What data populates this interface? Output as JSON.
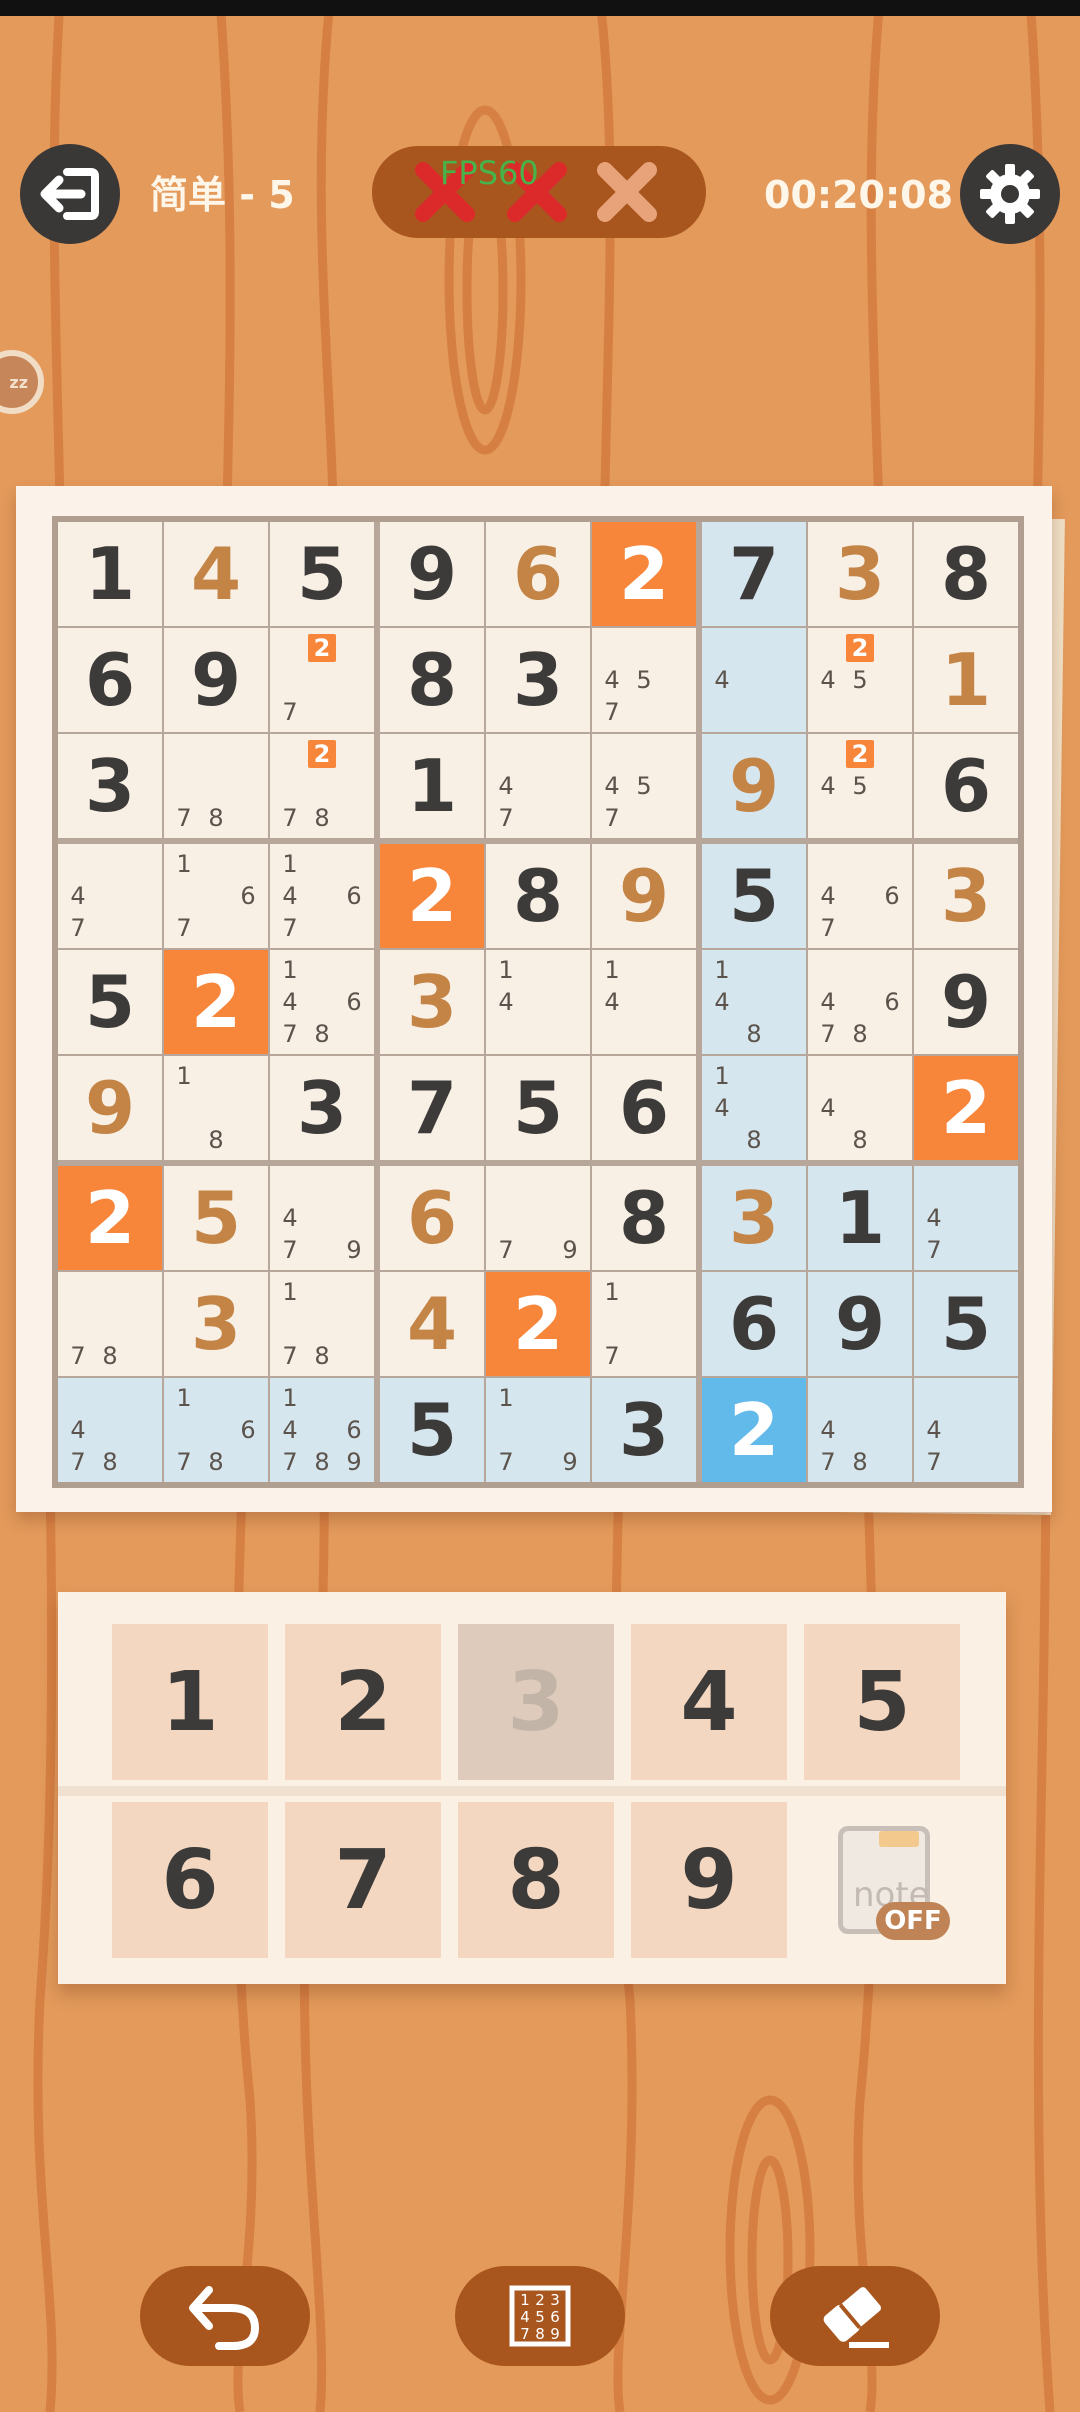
{
  "header": {
    "level_label": "简单 - 5",
    "timer": "00:20:08",
    "fps_overlay": "FPS60",
    "mistakes": {
      "made": 2,
      "max": 3
    },
    "exit_icon": "exit-icon",
    "settings_icon": "gear-icon"
  },
  "side_tab": {
    "label": "zz"
  },
  "board": {
    "selected_cell": [
      8,
      6
    ],
    "highlight_color": "#d6e6ee",
    "conflict_color": "#f7853a",
    "selected_color": "#62baea",
    "rows": [
      [
        {
          "v": "1",
          "t": "given"
        },
        {
          "v": "4",
          "t": "user"
        },
        {
          "v": "5",
          "t": "given"
        },
        {
          "v": "9",
          "t": "given"
        },
        {
          "v": "6",
          "t": "user"
        },
        {
          "v": "2",
          "t": "conf"
        },
        {
          "v": "7",
          "t": "given",
          "hl": true
        },
        {
          "v": "3",
          "t": "user"
        },
        {
          "v": "8",
          "t": "given"
        }
      ],
      [
        {
          "v": "6",
          "t": "given"
        },
        {
          "v": "9",
          "t": "given"
        },
        {
          "n": [
            7
          ],
          "o": [
            2
          ]
        },
        {
          "v": "8",
          "t": "given"
        },
        {
          "v": "3",
          "t": "given"
        },
        {
          "n": [
            4,
            5,
            7
          ]
        },
        {
          "n": [
            4
          ],
          "hl": true
        },
        {
          "n": [
            4,
            5
          ],
          "o": [
            2
          ]
        },
        {
          "v": "1",
          "t": "user"
        }
      ],
      [
        {
          "v": "3",
          "t": "given"
        },
        {
          "n": [
            7,
            8
          ]
        },
        {
          "n": [
            7,
            8
          ],
          "o": [
            2
          ]
        },
        {
          "v": "1",
          "t": "given"
        },
        {
          "n": [
            4,
            7
          ]
        },
        {
          "n": [
            4,
            5,
            7
          ]
        },
        {
          "v": "9",
          "t": "user",
          "hl": true
        },
        {
          "n": [
            4,
            5
          ],
          "o": [
            2
          ]
        },
        {
          "v": "6",
          "t": "given"
        }
      ],
      [
        {
          "n": [
            4,
            7
          ]
        },
        {
          "n": [
            1,
            6,
            7
          ]
        },
        {
          "n": [
            1,
            4,
            6,
            7
          ]
        },
        {
          "v": "2",
          "t": "conf"
        },
        {
          "v": "8",
          "t": "given"
        },
        {
          "v": "9",
          "t": "user"
        },
        {
          "v": "5",
          "t": "given",
          "hl": true
        },
        {
          "n": [
            4,
            6,
            7
          ]
        },
        {
          "v": "3",
          "t": "user"
        }
      ],
      [
        {
          "v": "5",
          "t": "given"
        },
        {
          "v": "2",
          "t": "conf"
        },
        {
          "n": [
            1,
            4,
            6,
            7,
            8
          ]
        },
        {
          "v": "3",
          "t": "user"
        },
        {
          "n": [
            1,
            4
          ]
        },
        {
          "n": [
            1,
            4
          ]
        },
        {
          "n": [
            1,
            4,
            8
          ],
          "hl": true
        },
        {
          "n": [
            4,
            6,
            7,
            8
          ]
        },
        {
          "v": "9",
          "t": "given"
        }
      ],
      [
        {
          "v": "9",
          "t": "user"
        },
        {
          "n": [
            1,
            8
          ]
        },
        {
          "v": "3",
          "t": "given"
        },
        {
          "v": "7",
          "t": "given"
        },
        {
          "v": "5",
          "t": "given"
        },
        {
          "v": "6",
          "t": "given"
        },
        {
          "n": [
            1,
            4,
            8
          ],
          "hl": true
        },
        {
          "n": [
            4,
            8
          ]
        },
        {
          "v": "2",
          "t": "conf"
        }
      ],
      [
        {
          "v": "2",
          "t": "conf"
        },
        {
          "v": "5",
          "t": "user"
        },
        {
          "n": [
            4,
            7,
            9
          ]
        },
        {
          "v": "6",
          "t": "user"
        },
        {
          "n": [
            7,
            9
          ]
        },
        {
          "v": "8",
          "t": "given"
        },
        {
          "v": "3",
          "t": "user",
          "hl": true
        },
        {
          "v": "1",
          "t": "given",
          "hl": true
        },
        {
          "n": [
            4,
            7
          ],
          "hl": true
        }
      ],
      [
        {
          "n": [
            7,
            8
          ]
        },
        {
          "v": "3",
          "t": "user"
        },
        {
          "n": [
            1,
            7,
            8
          ]
        },
        {
          "v": "4",
          "t": "user"
        },
        {
          "v": "2",
          "t": "conf"
        },
        {
          "n": [
            1,
            7
          ]
        },
        {
          "v": "6",
          "t": "given",
          "hl": true
        },
        {
          "v": "9",
          "t": "given",
          "hl": true
        },
        {
          "v": "5",
          "t": "given",
          "hl": true
        }
      ],
      [
        {
          "n": [
            4,
            7,
            8
          ],
          "hl": true
        },
        {
          "n": [
            1,
            6,
            7,
            8
          ],
          "hl": true
        },
        {
          "n": [
            1,
            4,
            6,
            7,
            8,
            9
          ],
          "hl": true
        },
        {
          "v": "5",
          "t": "given",
          "hl": true
        },
        {
          "n": [
            1,
            7,
            9
          ],
          "hl": true
        },
        {
          "v": "3",
          "t": "given",
          "hl": true
        },
        {
          "v": "2",
          "t": "sel"
        },
        {
          "n": [
            4,
            7,
            8
          ],
          "hl": true
        },
        {
          "n": [
            4,
            7
          ],
          "hl": true
        }
      ]
    ]
  },
  "number_pad": {
    "keys": [
      {
        "label": "1",
        "disabled": false
      },
      {
        "label": "2",
        "disabled": false
      },
      {
        "label": "3",
        "disabled": true
      },
      {
        "label": "4",
        "disabled": false
      },
      {
        "label": "5",
        "disabled": false
      },
      {
        "label": "6",
        "disabled": false
      },
      {
        "label": "7",
        "disabled": false
      },
      {
        "label": "8",
        "disabled": false
      },
      {
        "label": "9",
        "disabled": false
      }
    ],
    "note_toggle": {
      "label": "note",
      "state": "OFF",
      "icon": "clipboard-icon"
    }
  },
  "tools": [
    {
      "name": "undo-button",
      "icon": "undo-icon"
    },
    {
      "name": "auto-notes-button",
      "icon": "number-grid-icon",
      "label": "123456789"
    },
    {
      "name": "erase-button",
      "icon": "eraser-icon"
    }
  ]
}
